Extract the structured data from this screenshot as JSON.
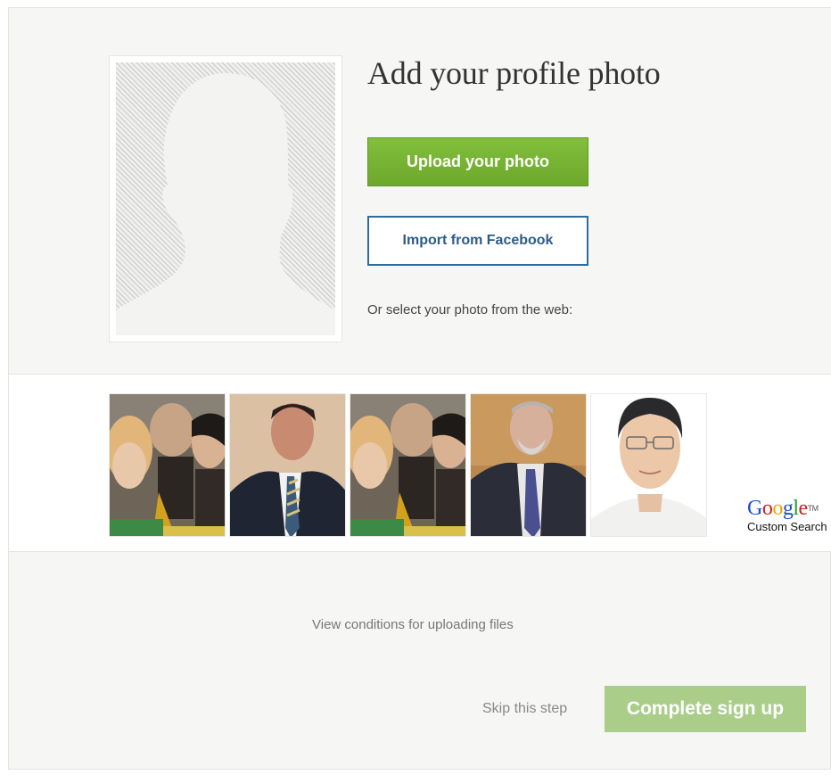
{
  "header": {
    "title": "Add your profile photo"
  },
  "actions": {
    "upload_label": "Upload your photo",
    "facebook_label": "Import from Facebook",
    "web_prompt": "Or select your photo from the web:"
  },
  "web_results": {
    "thumbnails": [
      {
        "name": "photo-result-1",
        "icon": "group-photo"
      },
      {
        "name": "photo-result-2",
        "icon": "man-in-suit-portrait"
      },
      {
        "name": "photo-result-3",
        "icon": "group-photo"
      },
      {
        "name": "photo-result-4",
        "icon": "man-in-suit-portrait"
      },
      {
        "name": "photo-result-5",
        "icon": "man-headshot"
      }
    ],
    "provider": {
      "letters": [
        "G",
        "o",
        "o",
        "g",
        "l",
        "e"
      ],
      "tm": "TM",
      "sub": "Custom Search",
      "colors": [
        "#1a4fcf",
        "#d02020",
        "#e8a800",
        "#1a4fcf",
        "#1f9c2b",
        "#d02020"
      ]
    }
  },
  "footer": {
    "conditions_link": "View conditions for uploading files",
    "skip_label": "Skip this step",
    "complete_label": "Complete sign up"
  },
  "colors": {
    "primary_green": "#6da82b",
    "disabled_green": "#aace8a",
    "facebook_blue": "#2f6a98",
    "background": "#f6f6f4"
  }
}
